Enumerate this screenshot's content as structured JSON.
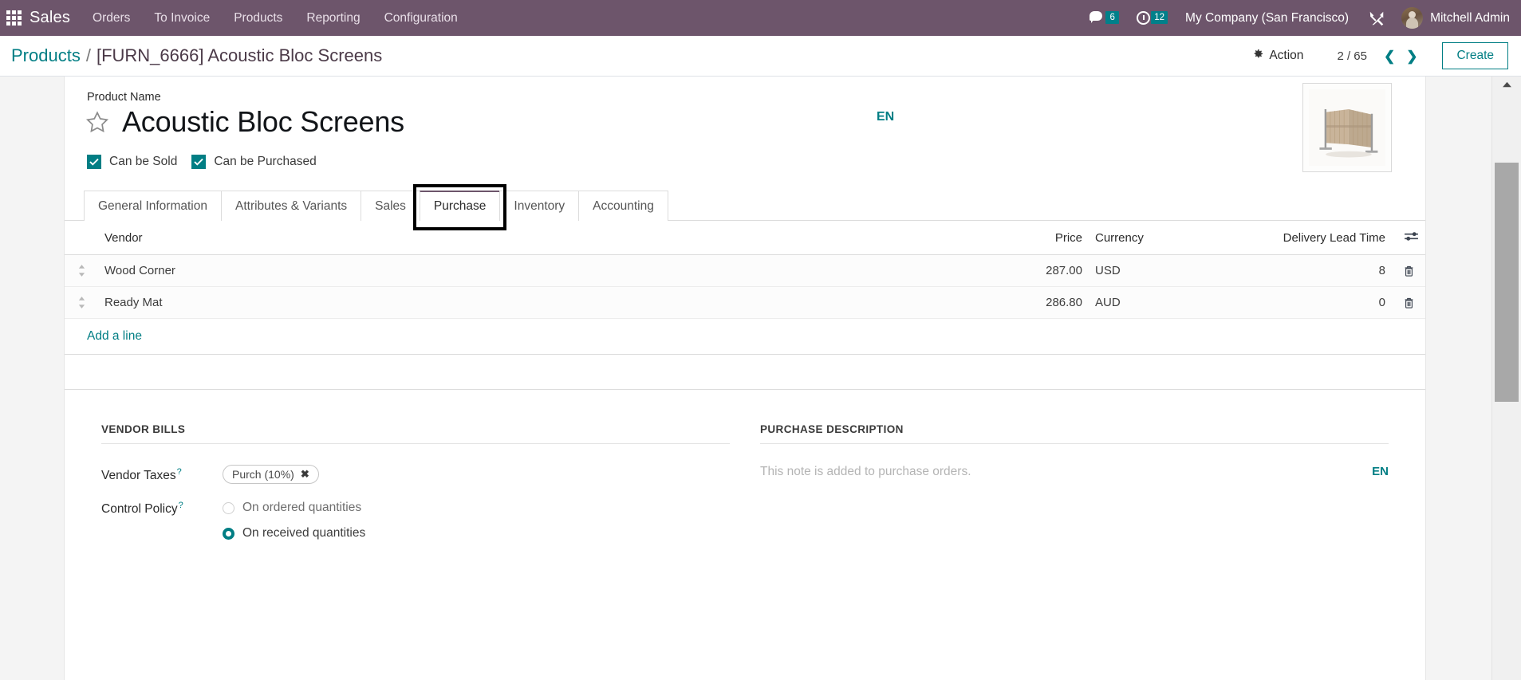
{
  "navbar": {
    "apps_icon": "apps-grid-icon",
    "brand": "Sales",
    "menu": [
      {
        "label": "Orders"
      },
      {
        "label": "To Invoice"
      },
      {
        "label": "Products"
      },
      {
        "label": "Reporting"
      },
      {
        "label": "Configuration"
      }
    ],
    "messages": {
      "icon": "chat-icon",
      "count": "6"
    },
    "activities": {
      "icon": "clock-icon",
      "count": "12"
    },
    "company": "My Company (San Francisco)",
    "tools_icon": "tools-icon",
    "user": "Mitchell Admin",
    "bg_color": "#6d556b",
    "badge_color": "#00808a"
  },
  "control_panel": {
    "breadcrumb_root": "Products",
    "breadcrumb_sep": "/",
    "breadcrumb_current": "[FURN_6666] Acoustic Bloc Screens",
    "action_label": "Action",
    "action_icon": "gear-icon",
    "pager": "2 / 65",
    "prev_icon": "chevron-left-icon",
    "next_icon": "chevron-right-icon",
    "create_label": "Create",
    "accent_color": "#017e84"
  },
  "form": {
    "product_name_label": "Product Name",
    "product_name": "Acoustic Bloc Screens",
    "favorite_icon": "star-outline-icon",
    "lang_badge": "EN",
    "image_alt": "acoustic-bloc-screens-product-image",
    "can_be_sold_label": "Can be Sold",
    "can_be_sold_checked": true,
    "can_be_purchased_label": "Can be Purchased",
    "can_be_purchased_checked": true
  },
  "tabs": [
    {
      "label": "General Information",
      "active": false
    },
    {
      "label": "Attributes & Variants",
      "active": false
    },
    {
      "label": "Sales",
      "active": false
    },
    {
      "label": "Purchase",
      "active": true,
      "highlighted": true
    },
    {
      "label": "Inventory",
      "active": false
    },
    {
      "label": "Accounting",
      "active": false
    }
  ],
  "vendor_table": {
    "headers": {
      "vendor": "Vendor",
      "price": "Price",
      "currency": "Currency",
      "lead_time": "Delivery Lead Time"
    },
    "options_icon": "column-options-icon",
    "rows": [
      {
        "handle_icon": "drag-handle-icon",
        "vendor": "Wood Corner",
        "price": "287.00",
        "currency": "USD",
        "lead_time": "8",
        "delete_icon": "trash-icon"
      },
      {
        "handle_icon": "drag-handle-icon",
        "vendor": "Ready Mat",
        "price": "286.80",
        "currency": "AUD",
        "lead_time": "0",
        "delete_icon": "trash-icon"
      }
    ],
    "add_line_label": "Add a line"
  },
  "vendor_bills": {
    "title": "VENDOR BILLS",
    "vendor_taxes_label": "Vendor Taxes",
    "vendor_taxes_tag": "Purch (10%)",
    "tag_remove_icon": "remove-tag-icon",
    "control_policy_label": "Control Policy",
    "control_policy_options": [
      {
        "label": "On ordered quantities",
        "selected": false
      },
      {
        "label": "On received quantities",
        "selected": true
      }
    ]
  },
  "purchase_description": {
    "title": "PURCHASE DESCRIPTION",
    "placeholder": "This note is added to purchase orders.",
    "lang_badge": "EN"
  },
  "scrollbar": {
    "up_icon": "scroll-up-arrow-icon"
  }
}
